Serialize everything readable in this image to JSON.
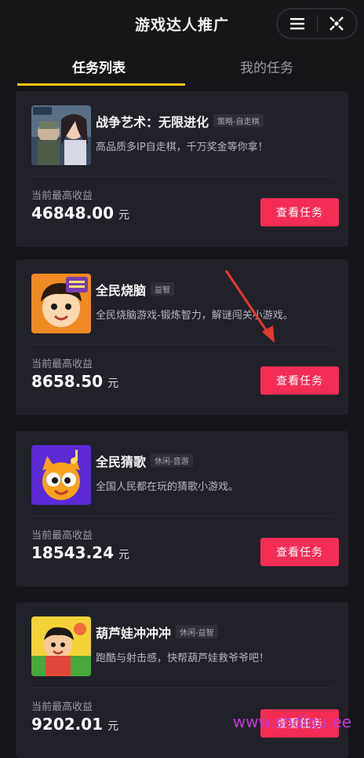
{
  "header": {
    "title": "游戏达人推广"
  },
  "tabs": [
    {
      "label": "任务列表"
    },
    {
      "label": "我的任务"
    }
  ],
  "earn_label": "当前最高收益",
  "button_label": "查看任务",
  "unit": "元",
  "tasks": [
    {
      "name": "战争艺术：无限进化",
      "tag": "策略-自走棋",
      "desc": "高品质多IP自走棋，千万奖金等你拿！",
      "earn": "46848.00"
    },
    {
      "name": "全民烧脑",
      "tag": "益智",
      "desc": "全民烧脑游戏-锻炼智力，解谜闯关小游戏。",
      "earn": "8658.50"
    },
    {
      "name": "全民猜歌",
      "tag": "休闲-音游",
      "desc": "全国人民都在玩的猜歌小游戏。",
      "earn": "18543.24"
    },
    {
      "name": "葫芦娃冲冲冲",
      "tag": "休闲-益智",
      "desc": "跑酷与射击感，快帮葫芦娃救爷爷吧！",
      "earn": "9202.01"
    }
  ],
  "watermark": "www.shdiqu.ee",
  "icons": {
    "menu": "menu-icon",
    "close": "close-icon"
  },
  "colors": {
    "accent": "#f42d55",
    "tab_underline": "#f2c40f"
  }
}
